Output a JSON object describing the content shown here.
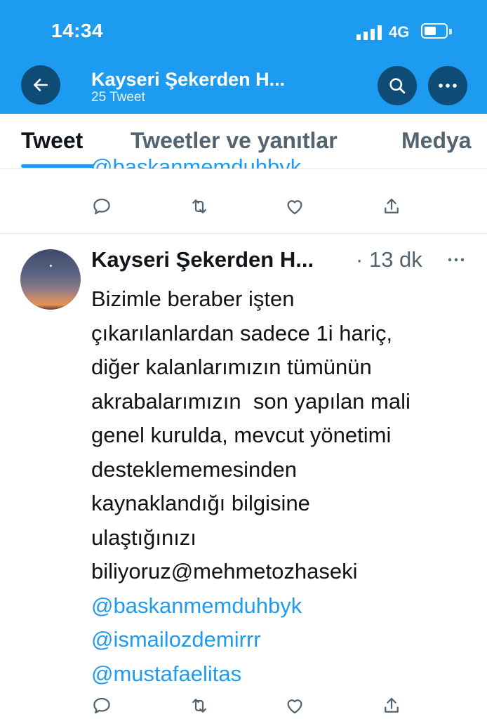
{
  "status_bar": {
    "time": "14:34",
    "network": "4G"
  },
  "header": {
    "title": "Kayseri Şekerden H...",
    "subtitle": "25 Tweet"
  },
  "tabs": [
    {
      "label": "Tweet",
      "active": true
    },
    {
      "label": "Tweetler ve yanıtlar",
      "active": false
    },
    {
      "label": "Medya",
      "active": false
    }
  ],
  "previous_tweet": {
    "partial_mention": "@baskanmemduhbyk"
  },
  "tweet": {
    "author": "Kayseri Şekerden H...",
    "separator": "·",
    "time": "13 dk",
    "lines": [
      "Bizimle beraber işten",
      "çıkarılanlardan sadece 1i hariç,",
      "diğer kalanlarımızın tümünün",
      "akrabalarımızın  son yapılan mali",
      "genel kurulda, mevcut yönetimi",
      "desteklememesinden",
      "kaynaklandığı bilgisine",
      "ulaştığınızı",
      "biliyoruz@mehmetozhaseki"
    ],
    "mentions": [
      "@baskanmemduhbyk",
      "@ismailozdemirrr",
      "@mustafaelitas"
    ]
  },
  "icons": [
    "back-arrow-icon",
    "search-icon",
    "more-icon",
    "reply-icon",
    "retweet-icon",
    "like-icon",
    "share-icon"
  ],
  "colors": {
    "brand": "#1d9bf0",
    "button_dark": "#0f4c75",
    "text": "#0f1419",
    "muted": "#536471"
  }
}
